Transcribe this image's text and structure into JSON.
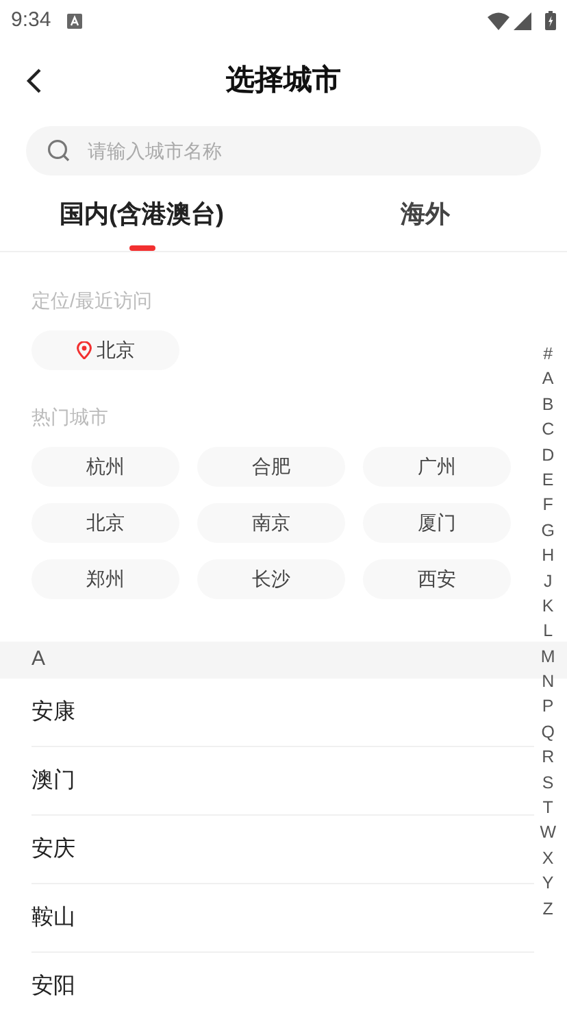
{
  "status_bar": {
    "time": "9:34"
  },
  "header": {
    "title": "选择城市"
  },
  "search": {
    "placeholder": "请输入城市名称"
  },
  "tabs": [
    {
      "label": "国内(含港澳台)",
      "selected": true
    },
    {
      "label": "海外",
      "selected": false
    }
  ],
  "recent": {
    "title": "定位/最近访问",
    "cities": [
      "北京"
    ]
  },
  "hot": {
    "title": "热门城市",
    "cities": [
      "杭州",
      "合肥",
      "广州",
      "北京",
      "南京",
      "厦门",
      "郑州",
      "长沙",
      "西安"
    ]
  },
  "sections": [
    {
      "letter": "A",
      "cities": [
        "安康",
        "澳门",
        "安庆",
        "鞍山",
        "安阳"
      ]
    }
  ],
  "index": [
    "#",
    "A",
    "B",
    "C",
    "D",
    "E",
    "F",
    "G",
    "H",
    "J",
    "K",
    "L",
    "M",
    "N",
    "P",
    "Q",
    "R",
    "S",
    "T",
    "W",
    "X",
    "Y",
    "Z"
  ]
}
